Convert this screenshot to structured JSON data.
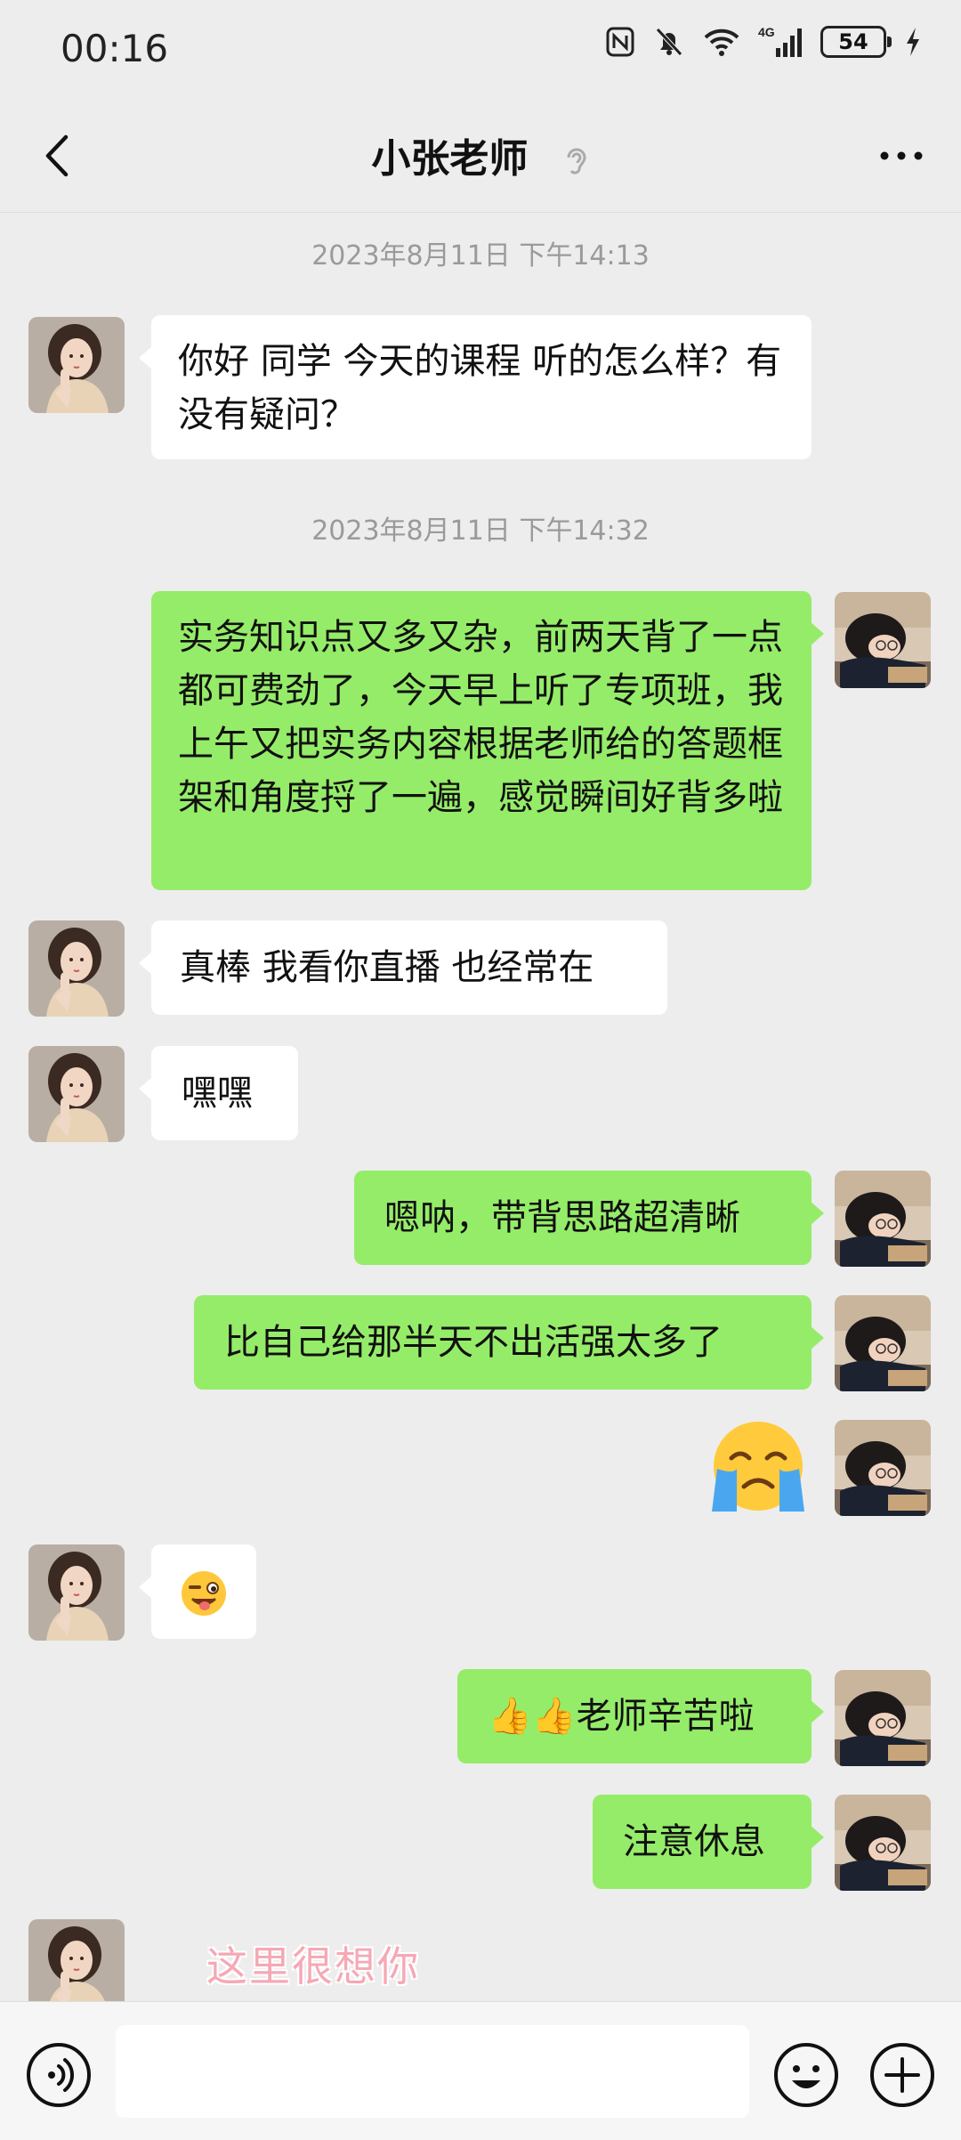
{
  "status_bar": {
    "time": "00:16",
    "network": "4G",
    "battery": "54"
  },
  "nav": {
    "title": "小张老师"
  },
  "timestamps": [
    "2023年8月11日 下午14:13",
    "2023年8月11日 下午14:32"
  ],
  "messages": [
    {
      "side": "in",
      "text": "你好 同学 今天的课程 听的怎么样？有没有疑问？"
    },
    {
      "side": "out",
      "text": "实务知识点又多又杂，前两天背了一点都可费劲了，今天早上听了专项班，我上午又把实务内容根据老师给的答题框架和角度捋了一遍，感觉瞬间好背多啦"
    },
    {
      "side": "in",
      "text": "真棒 我看你直播 也经常在"
    },
    {
      "side": "in",
      "text": "嘿嘿"
    },
    {
      "side": "out",
      "text": "嗯呐，带背思路超清晰"
    },
    {
      "side": "out",
      "text": "比自己给那半天不出活强太多了"
    },
    {
      "side": "out",
      "emoji": "crying-face"
    },
    {
      "side": "in",
      "emoji": "winking-tongue-face"
    },
    {
      "side": "out",
      "text": "👍👍老师辛苦啦"
    },
    {
      "side": "out",
      "text": "注意休息"
    },
    {
      "side": "in",
      "sticker_text": "这里很想你"
    }
  ],
  "colors": {
    "background": "#ededed",
    "incoming_bubble": "#ffffff",
    "outgoing_bubble": "#95ec69",
    "timestamp": "#9a9a9a"
  },
  "input_bar": {
    "placeholder": ""
  }
}
